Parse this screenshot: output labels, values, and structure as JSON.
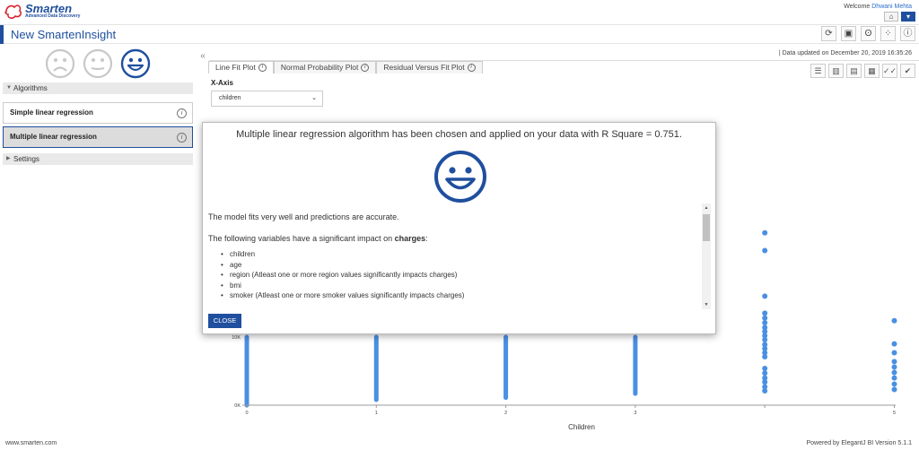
{
  "header": {
    "logo_name": "Smarten",
    "logo_tagline": "Advanced Data Discovery",
    "welcome_prefix": "Welcome",
    "user_name": "Dhwani Mehta",
    "home_icon": "home-icon",
    "menu_icon": "caret-down-icon"
  },
  "titlebar": {
    "title": "New SmartenInsight",
    "tools": [
      "refresh-icon",
      "save-icon",
      "brain-icon",
      "grid-icon",
      "info-icon"
    ]
  },
  "left_panel": {
    "faces": [
      "sad-face-icon",
      "neutral-face-icon",
      "happy-face-icon"
    ],
    "algorithms_heading": "Algorithms",
    "algorithms": [
      {
        "label": "Simple linear regression",
        "selected": false
      },
      {
        "label": "Multiple linear regression",
        "selected": true
      }
    ],
    "settings_heading": "Settings"
  },
  "main": {
    "data_updated": "Data updated on December 20, 2019 16:35:26",
    "tabs": [
      {
        "label": "Line Fit Plot",
        "active": true
      },
      {
        "label": "Normal Probability Plot",
        "active": false
      },
      {
        "label": "Residual Versus Fit Plot",
        "active": false
      }
    ],
    "view_tools": [
      "list-view-icon",
      "column-view-icon",
      "table-view-icon",
      "grid-view-icon",
      "double-check-icon",
      "check-icon"
    ],
    "xaxis_label": "X-Axis",
    "xaxis_value": "children"
  },
  "chart_data": {
    "type": "scatter",
    "xlabel": "Children",
    "ylabel": "",
    "x_ticks": [
      "0",
      "1",
      "2",
      "3",
      "",
      "5"
    ],
    "y_ticks": [
      "0K",
      "10K"
    ],
    "color": "#4a90e2",
    "columns": [
      {
        "x": 0,
        "y_min": 0,
        "y_max": 10000
      },
      {
        "x": 1,
        "y_min": 800,
        "y_max": 10000
      },
      {
        "x": 2,
        "y_min": 1100,
        "y_max": 10000
      },
      {
        "x": 3,
        "y_min": 1700,
        "y_max": 10000
      }
    ],
    "points": [
      {
        "x": 4,
        "y": 25300
      },
      {
        "x": 4,
        "y": 22700
      },
      {
        "x": 4,
        "y": 16000
      },
      {
        "x": 4,
        "y": 13500
      },
      {
        "x": 4,
        "y": 12800
      },
      {
        "x": 4,
        "y": 12100
      },
      {
        "x": 4,
        "y": 11400
      },
      {
        "x": 4,
        "y": 10800
      },
      {
        "x": 4,
        "y": 10200
      },
      {
        "x": 4,
        "y": 9600
      },
      {
        "x": 4,
        "y": 8900
      },
      {
        "x": 4,
        "y": 8300
      },
      {
        "x": 4,
        "y": 7700
      },
      {
        "x": 4,
        "y": 7100
      },
      {
        "x": 4,
        "y": 5400
      },
      {
        "x": 4,
        "y": 4700
      },
      {
        "x": 4,
        "y": 4000
      },
      {
        "x": 4,
        "y": 3400
      },
      {
        "x": 4,
        "y": 2700
      },
      {
        "x": 4,
        "y": 2100
      },
      {
        "x": 5,
        "y": 12400
      },
      {
        "x": 5,
        "y": 9000
      },
      {
        "x": 5,
        "y": 7700
      },
      {
        "x": 5,
        "y": 6400
      },
      {
        "x": 5,
        "y": 5600
      },
      {
        "x": 5,
        "y": 4800
      },
      {
        "x": 5,
        "y": 4000
      },
      {
        "x": 5,
        "y": 3100
      },
      {
        "x": 5,
        "y": 2300
      }
    ]
  },
  "modal": {
    "heading": "Multiple linear regression algorithm has been chosen and applied on your data with R Square = 0.751.",
    "face_icon": "happy-face-icon",
    "line1": "The model fits very well and predictions are accurate.",
    "line2_prefix": "The following variables have a significant impact on ",
    "line2_bold": "charges",
    "line2_suffix": ":",
    "variables": [
      "children",
      "age",
      "region (Atleast one or more region values significantly impacts charges)",
      "bmi",
      "smoker (Atleast one or more smoker values significantly impacts charges)"
    ],
    "close_label": "CLOSE"
  },
  "footer": {
    "left": "www.smarten.com",
    "right": "Powered by ElegantJ BI Version 5.1.1"
  }
}
